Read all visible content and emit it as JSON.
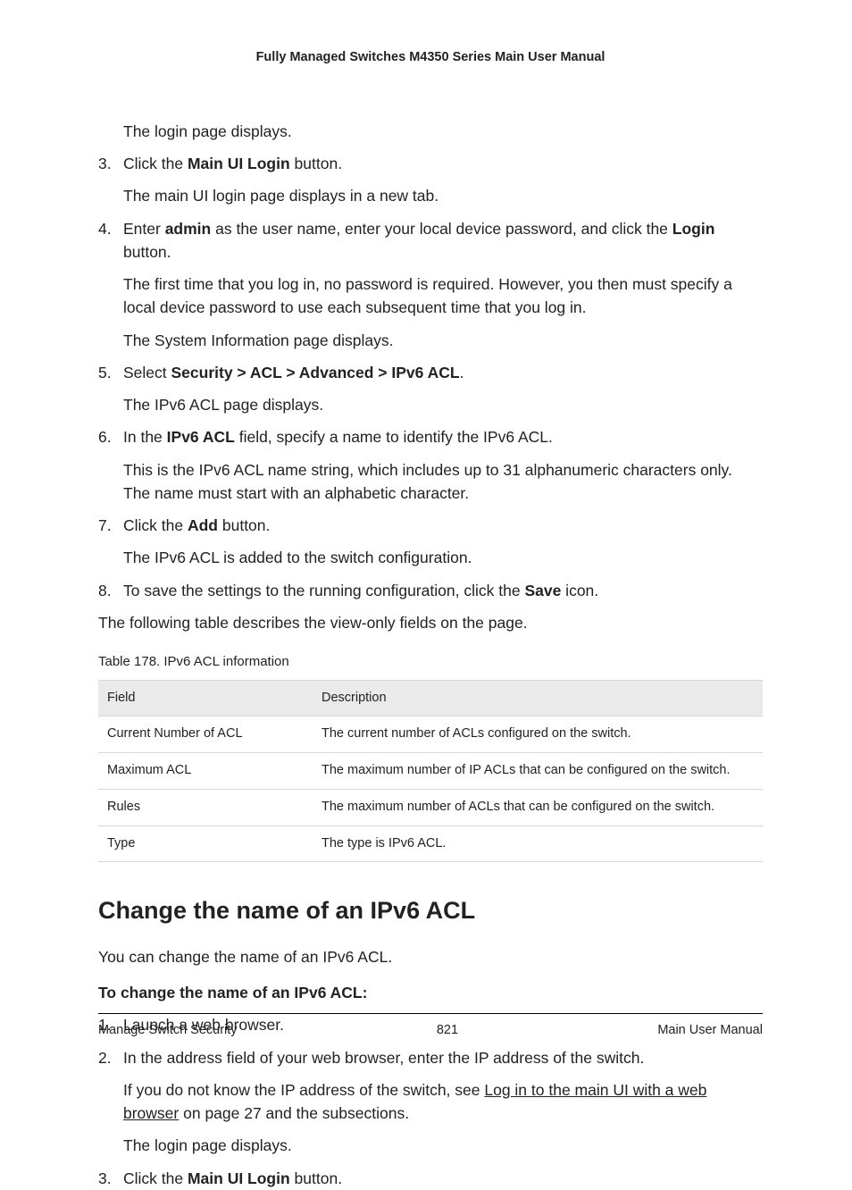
{
  "header": "Fully Managed Switches M4350 Series Main User Manual",
  "intro_indent": "The login page displays.",
  "steps": [
    {
      "parts": [
        {
          "t": "Click the "
        },
        {
          "t": "Main UI Login",
          "b": true
        },
        {
          "t": " button."
        }
      ],
      "after": [
        "The main UI login page displays in a new tab."
      ]
    },
    {
      "parts": [
        {
          "t": "Enter "
        },
        {
          "t": "admin",
          "b": true
        },
        {
          "t": " as the user name, enter your local device password, and click the "
        },
        {
          "t": "Login",
          "b": true
        },
        {
          "t": " button."
        }
      ],
      "after": [
        "The first time that you log in, no password is required. However, you then must specify a local device password to use each subsequent time that you log in.",
        "The System Information page displays."
      ]
    },
    {
      "parts": [
        {
          "t": "Select "
        },
        {
          "t": "Security > ACL > Advanced > IPv6 ACL",
          "b": true
        },
        {
          "t": "."
        }
      ],
      "after": [
        "The IPv6 ACL page displays."
      ]
    },
    {
      "parts": [
        {
          "t": "In the "
        },
        {
          "t": "IPv6 ACL",
          "b": true
        },
        {
          "t": " field, specify a name to identify the IPv6 ACL."
        }
      ],
      "after": [
        "This is the IPv6 ACL name string, which includes up to 31 alphanumeric characters only. The name must start with an alphabetic character."
      ]
    },
    {
      "parts": [
        {
          "t": "Click the "
        },
        {
          "t": "Add",
          "b": true
        },
        {
          "t": " button."
        }
      ],
      "after": [
        "The IPv6 ACL is added to the switch configuration."
      ]
    },
    {
      "parts": [
        {
          "t": "To save the settings to the running configuration, click the "
        },
        {
          "t": "Save",
          "b": true
        },
        {
          "t": " icon."
        }
      ],
      "after": []
    }
  ],
  "after_list": "The following table describes the view-only fields on the page.",
  "table_caption": "Table 178. IPv6 ACL information",
  "table": {
    "head": [
      "Field",
      "Description"
    ],
    "rows": [
      [
        "Current Number of ACL",
        "The current number of ACLs configured on the switch."
      ],
      [
        "Maximum ACL",
        "The maximum number of IP ACLs that can be configured on the switch."
      ],
      [
        "Rules",
        "The maximum number of ACLs that can be configured on the switch."
      ],
      [
        "Type",
        "The type is IPv6 ACL."
      ]
    ]
  },
  "section_title": "Change the name of an IPv6 ACL",
  "lead": "You can change the name of an IPv6 ACL.",
  "bold_lead": "To change the name of an IPv6 ACL:",
  "steps2": [
    {
      "parts": [
        {
          "t": "Launch a web browser."
        }
      ],
      "after": []
    },
    {
      "parts": [
        {
          "t": "In the address field of your web browser, enter the IP address of the switch."
        }
      ],
      "after_rich": [
        [
          {
            "t": "If you do not know the IP address of the switch, see "
          },
          {
            "t": "Log in to the main UI with a web browser",
            "u": true
          },
          {
            "t": " on page 27 and the subsections."
          }
        ],
        [
          {
            "t": "The login page displays."
          }
        ]
      ]
    },
    {
      "parts": [
        {
          "t": "Click the "
        },
        {
          "t": "Main UI Login",
          "b": true
        },
        {
          "t": " button."
        }
      ],
      "after": []
    }
  ],
  "footer": {
    "left": "Manage Switch Security",
    "center": "821",
    "right": "Main User Manual"
  }
}
